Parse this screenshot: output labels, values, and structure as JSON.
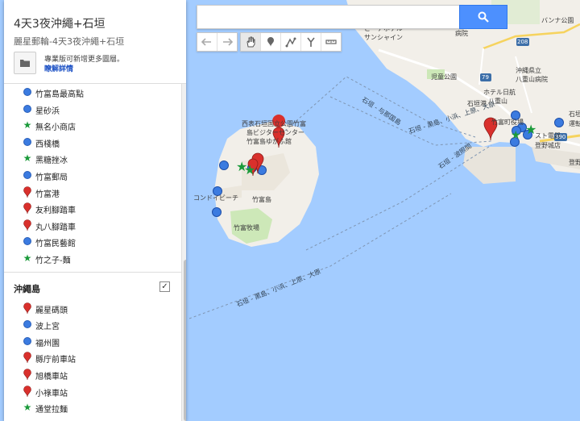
{
  "map": {
    "search_placeholder": "",
    "labels": {
      "island_center": "西表石垣国立公園竹富",
      "island_center2": "島ビジターセンター",
      "island_center3": "竹富島ゆがふ館",
      "beach": "コンドイビーチ",
      "taketomi": "竹富島",
      "farm": "竹富牧場",
      "port": "石垣港",
      "route1": "石垣 - 与那国島",
      "route2": "石垣 - 黒島、小浜、上原、大原",
      "route3": "石垣 - 波照間",
      "route4": "石垣 - 黒島、小浜、上原、大原",
      "hotel_top": "ビーチホテル",
      "hotel_top2": "サンシャイン",
      "hospital": "病院",
      "park": "児童公園",
      "okinawa_pref": "沖縄県立",
      "yaeyama_hosp": "八重山病院",
      "hotel_nikko": "ホテル日航",
      "hotel_nikko2": "八重山",
      "taketomi_terminal": "竹富町役場",
      "denki": "スト電器",
      "gallery": "登野城店",
      "banana": "バンナ公園",
      "road79": "79",
      "road208": "208",
      "road390": "390",
      "right_a": "石垣",
      "right_b": "運転",
      "right_c": "登野"
    }
  },
  "toolbar": {
    "undo": "undo",
    "redo": "redo",
    "pan": "pan",
    "marker": "add-marker",
    "line": "draw-line",
    "route": "add-directions",
    "measure": "measure"
  },
  "panel": {
    "title": "4天3夜沖繩+石垣",
    "subtitle": "麗星郵輪-4天3夜沖繩+石垣",
    "notice": "專業版可新增更多圖層。",
    "learn_more": "瞭解詳情"
  },
  "layer1": {
    "items": [
      {
        "label": "竹富島最高點",
        "icon": "dot"
      },
      {
        "label": "星砂浜",
        "icon": "dot"
      },
      {
        "label": "無名小商店",
        "icon": "star"
      },
      {
        "label": "西棧橋",
        "icon": "dot"
      },
      {
        "label": "黑糖挫冰",
        "icon": "star"
      },
      {
        "label": "竹富郵局",
        "icon": "dot"
      },
      {
        "label": "竹富港",
        "icon": "pin"
      },
      {
        "label": "友利腳踏車",
        "icon": "pin"
      },
      {
        "label": "丸八腳踏車",
        "icon": "pin"
      },
      {
        "label": "竹富民藝館",
        "icon": "dot"
      },
      {
        "label": "竹之子-麵",
        "icon": "star"
      }
    ]
  },
  "layer2": {
    "title": "沖繩島",
    "checked": "✓",
    "items": [
      {
        "label": "麗星碼頭",
        "icon": "pin"
      },
      {
        "label": "波上宮",
        "icon": "dot"
      },
      {
        "label": "福州園",
        "icon": "dot"
      },
      {
        "label": "縣庁前車站",
        "icon": "pin"
      },
      {
        "label": "旭橋車站",
        "icon": "pin"
      },
      {
        "label": "小祿車站",
        "icon": "pin"
      },
      {
        "label": "通堂拉麵",
        "icon": "star"
      }
    ]
  },
  "colors": {
    "water": "#a3ccff",
    "land": "#f2efe9",
    "park": "#cde8b8",
    "marker_blue": "#3b7be0",
    "marker_red": "#d9302c",
    "marker_green": "#1a9a3a",
    "search_button": "#4d90fe"
  }
}
